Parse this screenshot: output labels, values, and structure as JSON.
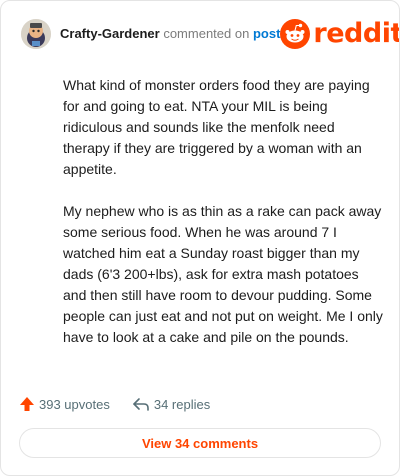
{
  "comment": {
    "username": "Crafty-Gardener",
    "action_text": "commented on",
    "target_link": "post",
    "paragraphs": [
      "What kind of monster orders food they are paying for and going to eat. NTA your MIL is being ridiculous and sounds like the menfolk need therapy if they are triggered by a woman with an appetite.",
      "My nephew who is as thin as a rake can pack away some serious food. When he was around 7 I watched him eat a Sunday roast bigger than my dads (6'3 200+lbs), ask for extra mash potatoes and then still have room to devour pudding. Some people can just eat and not put on weight. Me I only have to look at a cake and pile on the pounds."
    ]
  },
  "brand": {
    "name": "reddit",
    "color": "#ff4500"
  },
  "stats": {
    "upvotes_label": "393 upvotes",
    "replies_label": "34 replies"
  },
  "footer": {
    "view_button_label": "View 34 comments"
  },
  "icons": {
    "avatar": "user-avatar",
    "logo": "reddit-snoo-icon",
    "upvote": "upvote-arrow-icon",
    "reply": "reply-arrow-icon"
  },
  "colors": {
    "accent": "#ff4500",
    "link": "#0079d3",
    "muted": "#576f76"
  }
}
